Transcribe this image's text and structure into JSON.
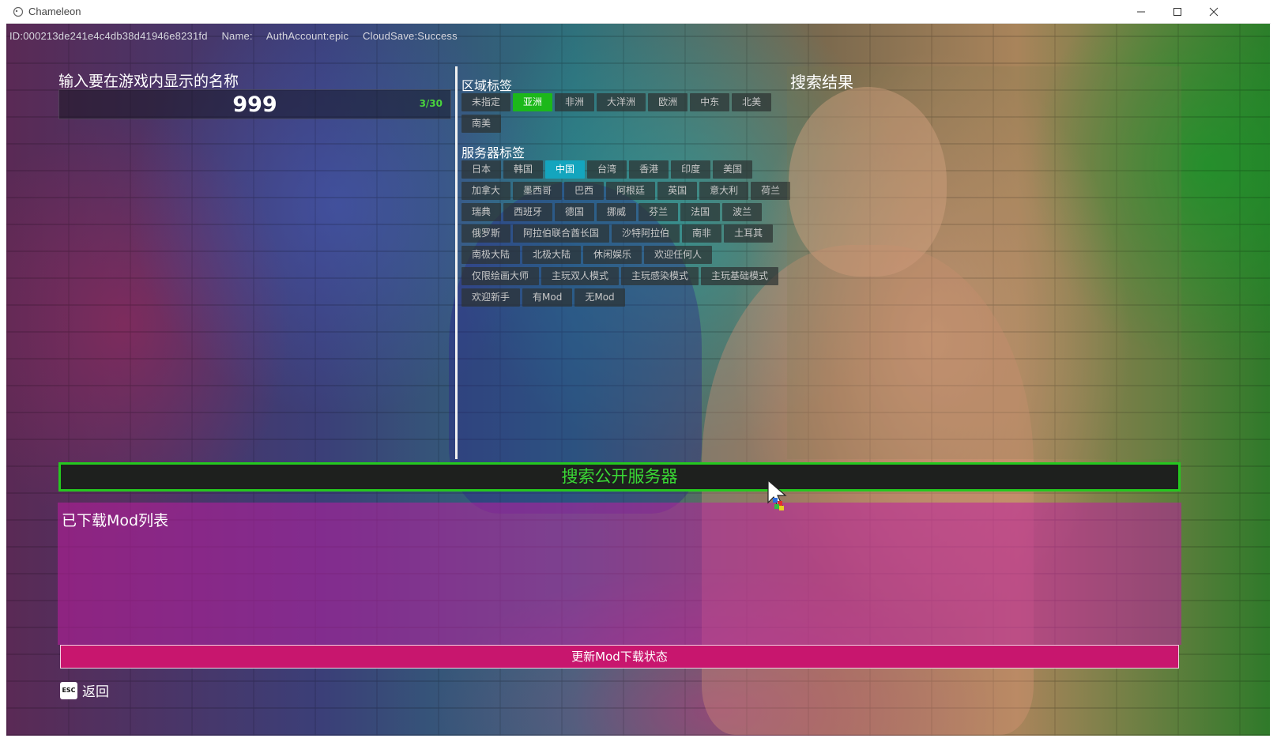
{
  "window": {
    "title": "Chameleon"
  },
  "status": {
    "id": "ID:000213de241e4c4db38d41946e8231fd",
    "name": "Name:",
    "auth": "AuthAccount:epic",
    "cloud": "CloudSave:Success"
  },
  "name_input": {
    "label": "输入要在游戏内显示的名称",
    "value": "999",
    "counter": "3/30"
  },
  "region": {
    "label": "区域标签",
    "tags": [
      "未指定",
      "亚洲",
      "非洲",
      "大洋洲",
      "欧洲",
      "中东",
      "北美",
      "南美"
    ],
    "selected": "亚洲"
  },
  "server": {
    "label": "服务器标签",
    "tags": [
      "日本",
      "韩国",
      "中国",
      "台湾",
      "香港",
      "印度",
      "美国",
      "加拿大",
      "墨西哥",
      "巴西",
      "阿根廷",
      "英国",
      "意大利",
      "荷兰",
      "瑞典",
      "西班牙",
      "德国",
      "挪威",
      "芬兰",
      "法国",
      "波兰",
      "俄罗斯",
      "阿拉伯联合酋长国",
      "沙特阿拉伯",
      "南非",
      "土耳其",
      "南极大陆",
      "北极大陆",
      "休闲娱乐",
      "欢迎任何人",
      "仅限绘画大师",
      "主玩双人模式",
      "主玩感染模式",
      "主玩基础模式",
      "欢迎新手",
      "有Mod",
      "无Mod"
    ],
    "selected": "中国"
  },
  "results": {
    "title": "搜索结果"
  },
  "search_button": {
    "label": "搜索公开服务器"
  },
  "mods": {
    "title": "已下载Mod列表",
    "update_label": "更新Mod下载状态"
  },
  "back": {
    "key": "ESC",
    "label": "返回"
  },
  "colors": {
    "accent_green": "#25c71f",
    "accent_cyan": "#14a5be",
    "accent_magenta": "#c8166e"
  }
}
